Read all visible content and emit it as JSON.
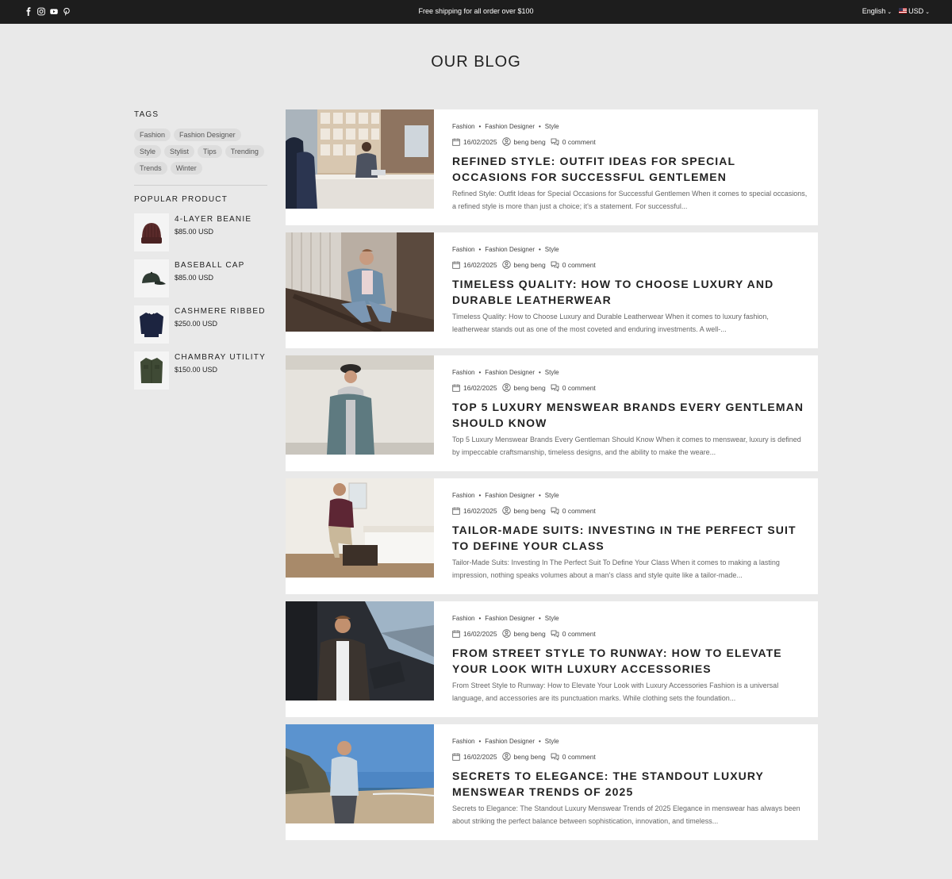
{
  "topbar": {
    "social_icons": [
      "facebook-icon",
      "instagram-icon",
      "youtube-icon",
      "pinterest-icon"
    ],
    "announcement": "Free shipping for all order over $100",
    "language": "English",
    "currency": "USD"
  },
  "page_title": "OUR BLOG",
  "sidebar": {
    "tags_heading": "TAGS",
    "tags": [
      "Fashion",
      "Fashion Designer",
      "Style",
      "Stylist",
      "Tips",
      "Trending",
      "Trends",
      "Winter"
    ],
    "popular_heading": "POPULAR PRODUCT",
    "products": [
      {
        "name": "4-LAYER BEANIE",
        "price": "$85.00 USD"
      },
      {
        "name": "BASEBALL CAP",
        "price": "$85.00 USD"
      },
      {
        "name": "CASHMERE RIBBED",
        "price": "$250.00 USD"
      },
      {
        "name": "CHAMBRAY UTILITY",
        "price": "$150.00 USD"
      }
    ]
  },
  "posts": [
    {
      "categories": [
        "Fashion",
        "Fashion Designer",
        "Style"
      ],
      "date": "16/02/2025",
      "author": "beng beng",
      "comments": "0 comment",
      "title": "REFINED STYLE: OUTFIT IDEAS FOR SPECIAL OCCASIONS FOR SUCCESSFUL GENTLEMEN",
      "excerpt": "Refined Style: Outfit Ideas for Special Occasions for Successful Gentlemen   When it comes to special occasions, a refined style is more than just a choice; it's a statement. For successful..."
    },
    {
      "categories": [
        "Fashion",
        "Fashion Designer",
        "Style"
      ],
      "date": "16/02/2025",
      "author": "beng beng",
      "comments": "0 comment",
      "title": "TIMELESS QUALITY: HOW TO CHOOSE LUXURY AND DURABLE LEATHERWEAR",
      "excerpt": "Timeless Quality: How to Choose Luxury and Durable Leatherwear   When it comes to luxury fashion, leatherwear stands out as one of the most coveted and enduring investments. A well-..."
    },
    {
      "categories": [
        "Fashion",
        "Fashion Designer",
        "Style"
      ],
      "date": "16/02/2025",
      "author": "beng beng",
      "comments": "0 comment",
      "title": "TOP 5 LUXURY MENSWEAR BRANDS EVERY GENTLEMAN SHOULD KNOW",
      "excerpt": "Top 5 Luxury Menswear Brands Every Gentleman Should Know   When it comes to menswear, luxury is defined by impeccable craftsmanship, timeless designs, and the ability to make the weare..."
    },
    {
      "categories": [
        "Fashion",
        "Fashion Designer",
        "Style"
      ],
      "date": "16/02/2025",
      "author": "beng beng",
      "comments": "0 comment",
      "title": "TAILOR-MADE SUITS: INVESTING IN THE PERFECT SUIT TO DEFINE YOUR CLASS",
      "excerpt": "Tailor-Made Suits: Investing In The Perfect Suit To Define Your Class   When it comes to making a lasting impression, nothing speaks volumes about a man's class and style quite like a tailor-made..."
    },
    {
      "categories": [
        "Fashion",
        "Fashion Designer",
        "Style"
      ],
      "date": "16/02/2025",
      "author": "beng beng",
      "comments": "0 comment",
      "title": "FROM STREET STYLE TO RUNWAY: HOW TO ELEVATE YOUR LOOK WITH LUXURY ACCESSORIES",
      "excerpt": "From Street Style to Runway: How to Elevate Your Look with Luxury Accessories   Fashion is a universal language, and accessories are its punctuation marks. While clothing sets the foundation..."
    },
    {
      "categories": [
        "Fashion",
        "Fashion Designer",
        "Style"
      ],
      "date": "16/02/2025",
      "author": "beng beng",
      "comments": "0 comment",
      "title": "SECRETS TO ELEGANCE: THE STANDOUT LUXURY MENSWEAR TRENDS OF 2025",
      "excerpt": "Secrets to Elegance: The Standout Luxury Menswear Trends of 2025   Elegance in menswear has always been about striking the perfect balance between sophistication, innovation, and timeless..."
    }
  ]
}
